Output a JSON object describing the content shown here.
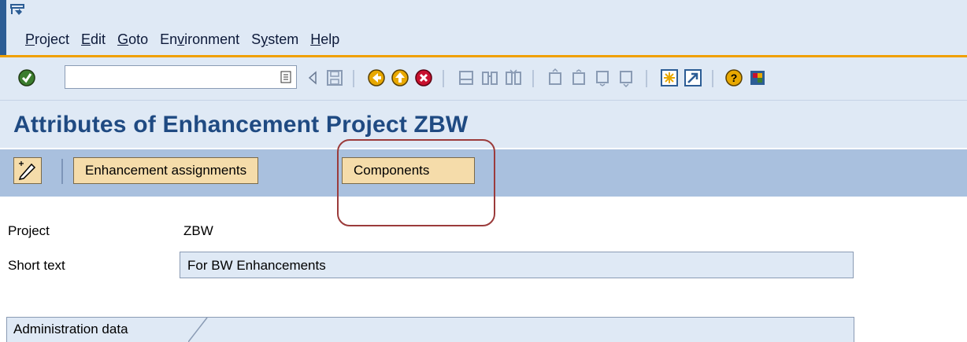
{
  "menu": {
    "items": [
      {
        "prefix": "",
        "underlined": "P",
        "rest": "roject"
      },
      {
        "prefix": "",
        "underlined": "E",
        "rest": "dit"
      },
      {
        "prefix": "",
        "underlined": "G",
        "rest": "oto"
      },
      {
        "prefix": "En",
        "underlined": "v",
        "rest": "ironment"
      },
      {
        "prefix": "S",
        "underlined": "y",
        "rest": "stem"
      },
      {
        "prefix": "",
        "underlined": "H",
        "rest": "elp"
      }
    ]
  },
  "command_field": {
    "value": ""
  },
  "page": {
    "title": "Attributes of Enhancement Project ZBW"
  },
  "app_toolbar": {
    "enhancement_assignments_label": "Enhancement assignments",
    "components_label": "Components"
  },
  "form": {
    "project_label": "Project",
    "project_value": "ZBW",
    "short_text_label": "Short text",
    "short_text_value": "For BW Enhancements"
  },
  "admin": {
    "tab_label": "Administration data"
  },
  "colors": {
    "title": "#1f4a82",
    "button": "#f5dcaa",
    "app_toolbar": "#a9c0de",
    "highlight": "#9b3b3b"
  },
  "icons": [
    "system-menu-icon",
    "enter-icon",
    "command-dropdown-icon",
    "save-icon",
    "back-icon",
    "exit-icon",
    "cancel-icon",
    "print-icon",
    "find-icon",
    "find-next-icon",
    "first-page-icon",
    "previous-page-icon",
    "next-page-icon",
    "last-page-icon",
    "create-session-icon",
    "shortcut-icon",
    "help-icon",
    "layout-menu-icon",
    "pencil-icon"
  ]
}
